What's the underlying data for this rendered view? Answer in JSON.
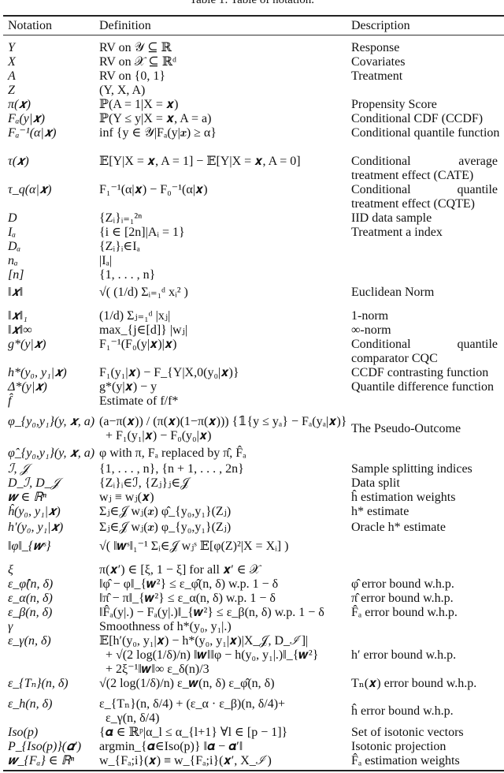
{
  "caption": "Table 1: Table of notation.",
  "headers": [
    "Notation",
    "Definition",
    "Description"
  ],
  "rows": [
    {
      "notation": "Y",
      "definition": "RV on 𝒴 ⊆ ℝ",
      "description": "Response"
    },
    {
      "notation": "X",
      "definition": "RV on 𝒳 ⊆ ℝᵈ",
      "description": "Covariates"
    },
    {
      "notation": "A",
      "definition": "RV on {0, 1}",
      "description": "Treatment"
    },
    {
      "notation": "Z",
      "definition": "(Y, X, A)",
      "description": ""
    },
    {
      "notation": "π(𝒙)",
      "definition": "ℙ(A = 1|X = 𝒙)",
      "description": "Propensity Score"
    },
    {
      "notation": "Fₐ(y|𝒙)",
      "definition": "ℙ(Y ≤ y|X = 𝒙, A = a)",
      "description": "Conditional CDF (CCDF)"
    },
    {
      "notation": "Fₐ⁻¹(α|𝒙)",
      "definition": "inf {y ∈ 𝒴|Fₐ(y|𝒙) ≥ α}",
      "description": "Conditional quantile function"
    },
    {
      "notation": "τ(𝒙)",
      "definition": "𝔼[Y|X = 𝒙, A = 1] − 𝔼[Y|X = 𝒙, A = 0]",
      "description": "Conditional average treatment effect (CATE)"
    },
    {
      "notation": "τ_q(α|𝒙)",
      "definition": "F₁⁻¹(α|𝒙) − F₀⁻¹(α|𝒙)",
      "description": "Conditional quantile treatment effect (CQTE)"
    },
    {
      "notation": "D",
      "definition": "{Zᵢ}ᵢ₌₁²ⁿ",
      "description": "IID data sample"
    },
    {
      "notation": "Iₐ",
      "definition": "{i ∈ [2n]|Aᵢ = 1}",
      "description": "Treatment a index"
    },
    {
      "notation": "Dₐ",
      "definition": "{Zᵢ}ᵢ∈Iₐ",
      "description": ""
    },
    {
      "notation": "nₐ",
      "definition": "|Iₐ|",
      "description": ""
    },
    {
      "notation": "[n]",
      "definition": "{1, . . . , n}",
      "description": ""
    },
    {
      "notation": "‖𝒙‖",
      "definition": "√( (1/d) Σᵢ₌₁ᵈ xᵢ² )",
      "description": "Euclidean Norm"
    },
    {
      "notation": "‖𝒙‖₁",
      "definition": "(1/d) Σⱼ₌₁ᵈ |xⱼ|",
      "description": "1-norm"
    },
    {
      "notation": "‖𝒙‖∞",
      "definition": "max_{j∈[d]} |wⱼ|",
      "description": "∞-norm"
    },
    {
      "notation": "g*(y|𝒙)",
      "definition": "F₁⁻¹(F₀(y|𝒙)|𝒙)",
      "description": "Conditional quantile comparator CQC"
    },
    {
      "notation": "h*(y₀, y₁|𝒙)",
      "definition": "F₁(y₁|𝒙) − F_{Y|X,0(y₀|𝒙)}",
      "description": "CCDF contrasting function"
    },
    {
      "notation": "Δ*(y|𝒙)",
      "definition": "g*(y|𝒙) − y",
      "description": "Quantile difference function"
    },
    {
      "notation": "f̂",
      "definition": "Estimate of f/f*",
      "description": ""
    },
    {
      "notation": "φ_{y₀,y₁}(y, 𝒙, a)",
      "definition_line1": "(a−π(𝒙)) / (π(𝒙)(1−π(𝒙))) {𝟙{y ≤ yₐ} − Fₐ(yₐ|𝒙)}",
      "definition_line2": "+ F₁(y₁|𝒙) − F₀(y₀|𝒙)",
      "description": "The Pseudo-Outcome"
    },
    {
      "notation": "φ̂_{y₀,y₁}(y, 𝒙, a)",
      "definition": "φ with π, Fₐ replaced by π̂, F̂ₐ",
      "description": ""
    },
    {
      "notation": "ℐ, 𝒥",
      "definition": "{1, . . . , n}, {n + 1, . . . , 2n}",
      "description": "Sample splitting indices"
    },
    {
      "notation": "D_ℐ, D_𝒥",
      "definition": "{Zᵢ}ᵢ∈ℐ, {Zⱼ}ⱼ∈𝒥",
      "description": "Data split"
    },
    {
      "notation": "𝒘 ∈ ℝⁿ",
      "definition": "wⱼ ≡ wⱼ(𝒙)",
      "description": "ĥ estimation weights"
    },
    {
      "notation": "ĥ(y₀, y₁|𝒙)",
      "definition": "Σⱼ∈𝒥 wⱼ(𝒙) φ̂_{y₀,y₁}(Zⱼ)",
      "description": "h* estimate"
    },
    {
      "notation": "h′(y₀, y₁|𝒙)",
      "definition": "Σⱼ∈𝒥 wⱼ(𝒙) φ_{y₀,y₁}(Zⱼ)",
      "description": "Oracle h* estimate"
    },
    {
      "notation": "‖φ‖_{𝒘ˢ}",
      "definition": "√( ‖𝒘ˢ‖₁⁻¹ Σᵢ∈𝒥 wⱼˢ 𝔼[φ(Z)²|X = Xᵢ] )",
      "description": ""
    },
    {
      "notation": "ξ",
      "definition": "π(𝒙′) ∈ [ξ, 1 − ξ] for all 𝒙′ ∈ 𝒳",
      "description": ""
    },
    {
      "notation": "ε_φ̂(n, δ)",
      "definition": "‖φ̂ − φ‖_{𝒘²} ≤ ε_φ̂(n, δ) w.p. 1 − δ",
      "description": "φ̂ error bound w.h.p."
    },
    {
      "notation": "ε_α(n, δ)",
      "definition": "‖π̂ − π‖_{𝒘²} ≤ ε_α(n, δ) w.p. 1 − δ",
      "description": "π̂ error bound w.h.p."
    },
    {
      "notation": "ε_β(n, δ)",
      "definition": "‖F̂ₐ(y|.) − Fₐ(y|.)‖_{𝒘²} ≤ ε_β(n, δ) w.p. 1 − δ",
      "description": "F̂ₐ error bound w.h.p."
    },
    {
      "notation": "γ",
      "definition": "Smoothness of h*(y₀, y₁|.)",
      "description": ""
    },
    {
      "notation": "ε_γ(n, δ)",
      "definition_line1": "𝔼[h′(y₀, y₁|𝒙) − h*(y₀, y₁|𝒙)|X_𝒥, D_ℐ]|",
      "definition_line2": "+ √(2 log(1/δ)/n) ‖𝒘‖‖φ − h(y₀, y₁|.)‖_{𝒘²}",
      "definition_line3": "+ 2ξ⁻¹‖𝒘‖∞ ε_δ(n)/3",
      "description": "h′ error bound w.h.p."
    },
    {
      "notation": "ε_{Tₙ}(n, δ)",
      "definition": "√(2 log(1/δ)/n) ε_𝒘(n, δ) ε_φ̂(n, δ)",
      "description": "Tₙ(𝒙) error bound w.h.p."
    },
    {
      "notation": "ε_h(n, δ)",
      "definition_line1": "ε_{Tₙ}(n, δ/4) + (ε_α · ε_β)(n, δ/4)+",
      "definition_line2": "ε_γ(n, δ/4)",
      "description": "ĥ error bound w.h.p."
    },
    {
      "notation": "Iso(p)",
      "definition": "{𝜶 ∈ ℝᵖ|α_l ≤ α_{l+1} ∀l ∈ [p − 1]}",
      "description": "Set of isotonic vectors"
    },
    {
      "notation": "P_{Iso(p)}(𝜶′)",
      "definition": "argmin_{𝜶∈Iso(p)} ‖𝜶 − 𝜶′‖",
      "description": "Isotonic projection"
    },
    {
      "notation": "𝒘_{Fₐ} ∈ ℝⁿ",
      "definition": "w_{Fₐ;i}(𝒙) ≡ w_{Fₐ;i}(𝒙′, X_ℐ)",
      "description": "F̂ₐ estimation weights"
    }
  ]
}
